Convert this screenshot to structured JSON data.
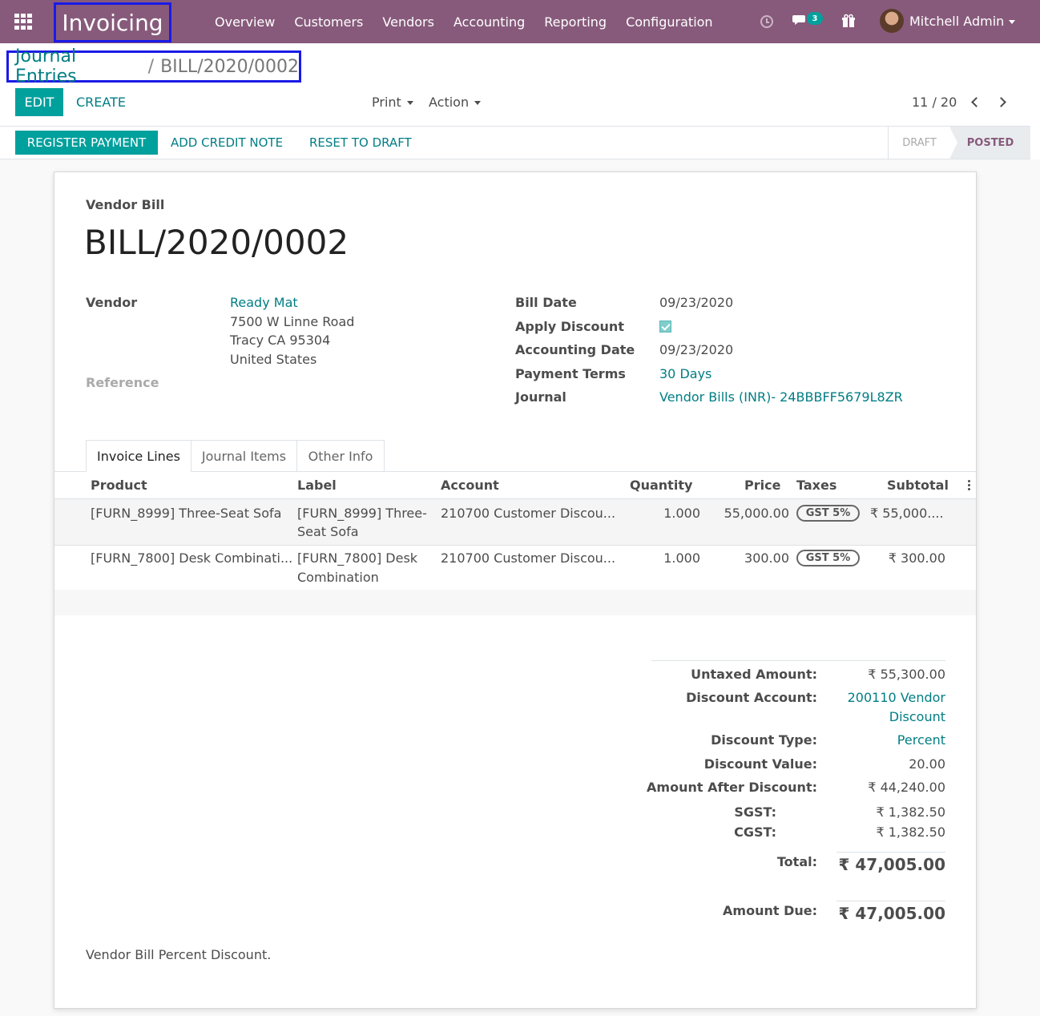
{
  "navbar": {
    "brand": "Invoicing",
    "menu": [
      "Overview",
      "Customers",
      "Vendors",
      "Accounting",
      "Reporting",
      "Configuration"
    ],
    "chat_count": "3",
    "user_name": "Mitchell Admin",
    "color": "#875a7b"
  },
  "breadcrumb": {
    "parent": "Journal Entries",
    "separator": "/",
    "current": "BILL/2020/0002"
  },
  "controls": {
    "edit": "EDIT",
    "create": "CREATE",
    "print": "Print",
    "action": "Action",
    "pager": "11 / 20"
  },
  "statusbar": {
    "register_payment": "REGISTER PAYMENT",
    "add_credit_note": "ADD CREDIT NOTE",
    "reset_to_draft": "RESET TO DRAFT",
    "stages": [
      "DRAFT",
      "POSTED"
    ],
    "active_stage": "POSTED"
  },
  "bill": {
    "type_label": "Vendor Bill",
    "name": "BILL/2020/0002",
    "vendor_label": "Vendor",
    "vendor_name": "Ready Mat",
    "vendor_address": [
      "7500 W Linne Road",
      "Tracy CA 95304",
      "United States"
    ],
    "reference_label": "Reference",
    "bill_date_label": "Bill Date",
    "bill_date": "09/23/2020",
    "apply_discount_label": "Apply Discount",
    "apply_discount": true,
    "accounting_date_label": "Accounting Date",
    "accounting_date": "09/23/2020",
    "payment_terms_label": "Payment Terms",
    "payment_terms": "30 Days",
    "journal_label": "Journal",
    "journal": "Vendor Bills (INR)- 24BBBFF5679L8ZR"
  },
  "tabs": [
    "Invoice Lines",
    "Journal Items",
    "Other Info"
  ],
  "table": {
    "headers": [
      "Product",
      "Label",
      "Account",
      "Quantity",
      "Price",
      "Taxes",
      "Subtotal"
    ],
    "rows": [
      {
        "product": "[FURN_8999] Three-Seat Sofa",
        "label_1": "[FURN_8999] Three-",
        "label_2": "Seat Sofa",
        "account": "210700 Customer Discou...",
        "quantity": "1.000",
        "price": "55,000.00",
        "tax": "GST 5%",
        "subtotal": "₹ 55,000...."
      },
      {
        "product": "[FURN_7800] Desk Combinati...",
        "label_1": "[FURN_7800] Desk",
        "label_2": "Combination",
        "account": "210700 Customer Discou...",
        "quantity": "1.000",
        "price": "300.00",
        "tax": "GST 5%",
        "subtotal": "₹ 300.00"
      }
    ]
  },
  "totals": {
    "untaxed_label": "Untaxed Amount:",
    "untaxed": "₹ 55,300.00",
    "discount_account_label": "Discount Account:",
    "discount_account_1": "200110 Vendor",
    "discount_account_2": "Discount",
    "discount_type_label": "Discount Type:",
    "discount_type": "Percent",
    "discount_value_label": "Discount Value:",
    "discount_value": "20.00",
    "after_discount_label": "Amount After Discount:",
    "after_discount": "₹ 44,240.00",
    "sgst_label": "SGST:",
    "sgst": "₹ 1,382.50",
    "cgst_label": "CGST:",
    "cgst": "₹ 1,382.50",
    "total_label": "Total:",
    "total": "₹ 47,005.00",
    "amount_due_label": "Amount Due:",
    "amount_due": "₹ 47,005.00"
  },
  "narration": "Vendor Bill Percent Discount."
}
